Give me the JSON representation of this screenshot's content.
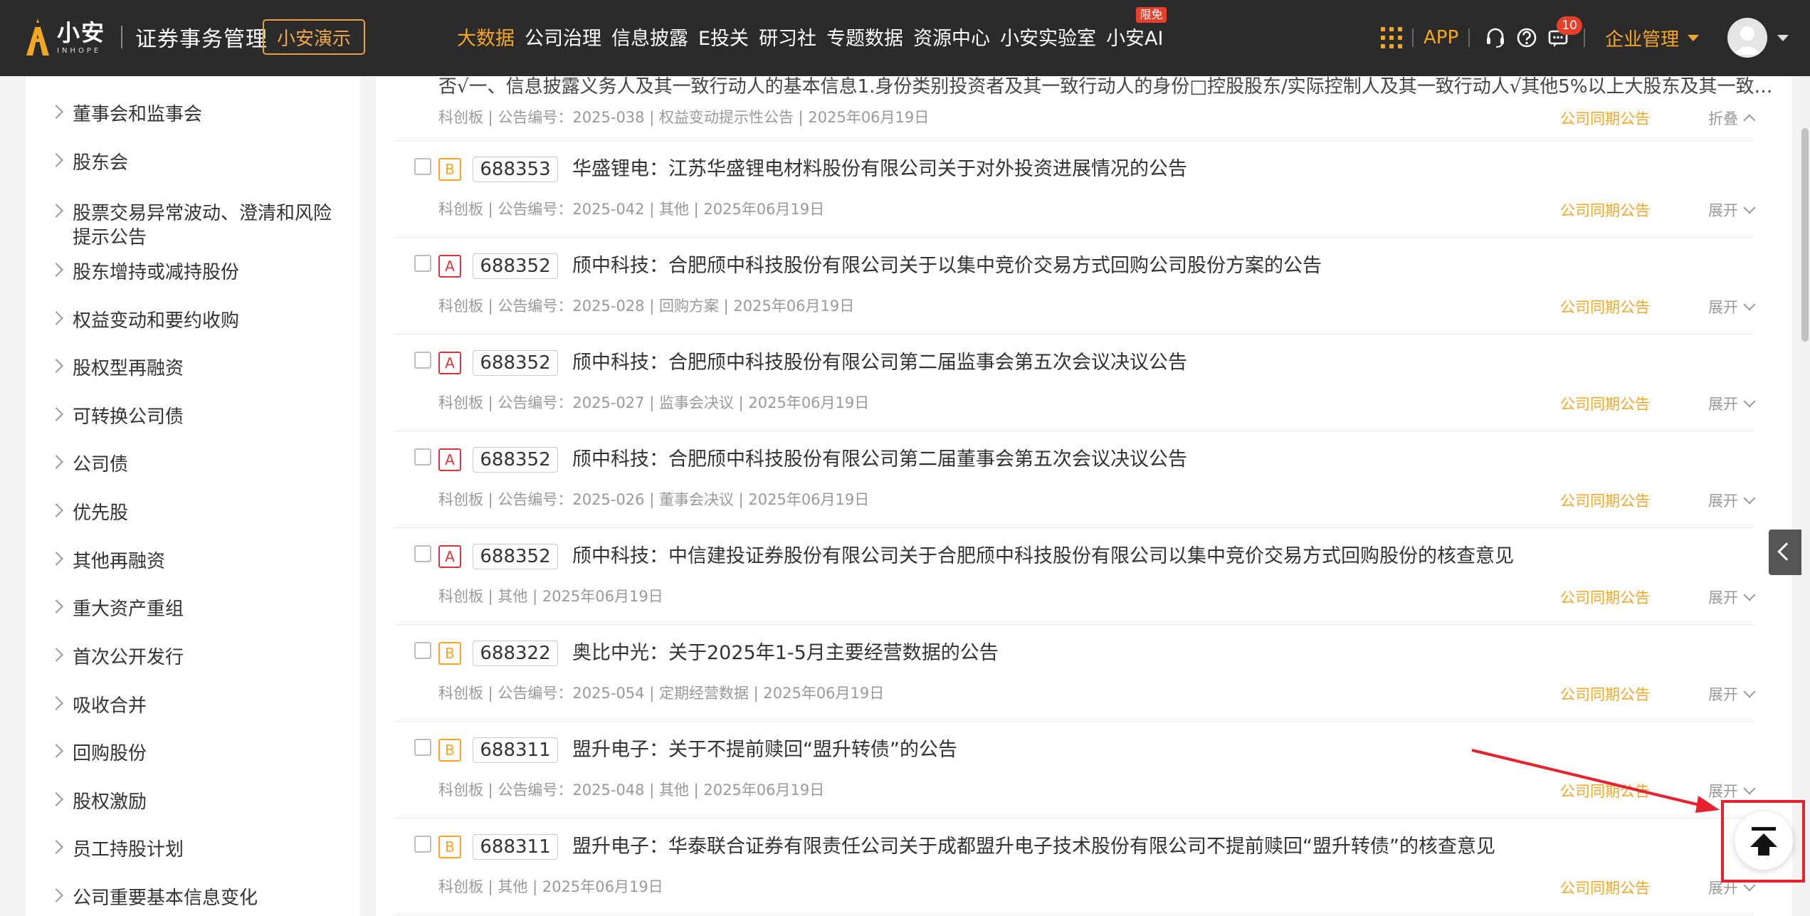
{
  "header": {
    "logo_main": "小安",
    "logo_sub": "INHOPE",
    "app_title": "证券事务管理",
    "demo_button": "小安演示",
    "nav": [
      {
        "label": "大数据",
        "active": true
      },
      {
        "label": "公司治理"
      },
      {
        "label": "信息披露"
      },
      {
        "label": "E投关"
      },
      {
        "label": "研习社"
      },
      {
        "label": "专题数据"
      },
      {
        "label": "资源中心"
      },
      {
        "label": "小安实验室"
      },
      {
        "label": "小安AI",
        "badge": "限免"
      }
    ],
    "app_link": "APP",
    "message_count": "10",
    "enterprise_menu": "企业管理"
  },
  "sidebar": {
    "items": [
      {
        "label": "董事会和监事会"
      },
      {
        "label": "股东会"
      },
      {
        "label": "股票交易异常波动、澄清和风险提示公告"
      },
      {
        "label": "股东增持或减持股份"
      },
      {
        "label": "权益变动和要约收购"
      },
      {
        "label": "股权型再融资"
      },
      {
        "label": "可转换公司债"
      },
      {
        "label": "公司债"
      },
      {
        "label": "优先股"
      },
      {
        "label": "其他再融资"
      },
      {
        "label": "重大资产重组"
      },
      {
        "label": "首次公开发行"
      },
      {
        "label": "吸收合并"
      },
      {
        "label": "回购股份"
      },
      {
        "label": "股权激励"
      },
      {
        "label": "员工持股计划"
      },
      {
        "label": "公司重要基本信息变化"
      }
    ]
  },
  "list": {
    "truncated_row": {
      "text": "否√一、信息披露义务人及其一致行动人的基本信息1.身份类别投资者及其一致行动人的身份□控股股东/实际控制人及其一致行动人√其他5%以上大股东及其一致行动人…",
      "meta": "科创板 | 公告编号：2025-038 | 权益变动提示性公告 | 2025年06月19日",
      "peer": "公司同期公告",
      "toggle": "折叠"
    },
    "rows": [
      {
        "grade": "B",
        "code": "688353",
        "title": "华盛锂电：江苏华盛锂电材料股份有限公司关于对外投资进展情况的公告",
        "meta": "科创板 | 公告编号：2025-042 | 其他 | 2025年06月19日",
        "peer": "公司同期公告",
        "toggle": "展开"
      },
      {
        "grade": "A",
        "code": "688352",
        "title": "颀中科技：合肥颀中科技股份有限公司关于以集中竞价交易方式回购公司股份方案的公告",
        "meta": "科创板 | 公告编号：2025-028 | 回购方案 | 2025年06月19日",
        "peer": "公司同期公告",
        "toggle": "展开"
      },
      {
        "grade": "A",
        "code": "688352",
        "title": "颀中科技：合肥颀中科技股份有限公司第二届监事会第五次会议决议公告",
        "meta": "科创板 | 公告编号：2025-027 | 监事会决议 | 2025年06月19日",
        "peer": "公司同期公告",
        "toggle": "展开"
      },
      {
        "grade": "A",
        "code": "688352",
        "title": "颀中科技：合肥颀中科技股份有限公司第二届董事会第五次会议决议公告",
        "meta": "科创板 | 公告编号：2025-026 | 董事会决议 | 2025年06月19日",
        "peer": "公司同期公告",
        "toggle": "展开"
      },
      {
        "grade": "A",
        "code": "688352",
        "title": "颀中科技：中信建投证券股份有限公司关于合肥颀中科技股份有限公司以集中竞价交易方式回购股份的核查意见",
        "meta": "科创板 | 其他 | 2025年06月19日",
        "peer": "公司同期公告",
        "toggle": "展开"
      },
      {
        "grade": "B",
        "code": "688322",
        "title": "奥比中光：关于2025年1-5月主要经营数据的公告",
        "meta": "科创板 | 公告编号：2025-054 | 定期经营数据 | 2025年06月19日",
        "peer": "公司同期公告",
        "toggle": "展开"
      },
      {
        "grade": "B",
        "code": "688311",
        "title": "盟升电子：关于不提前赎回“盟升转债”的公告",
        "meta": "科创板 | 公告编号：2025-048 | 其他 | 2025年06月19日",
        "peer": "公司同期公告",
        "toggle": "展开"
      },
      {
        "grade": "B",
        "code": "688311",
        "title": "盟升电子：华泰联合证券有限责任公司关于成都盟升电子技术股份有限公司不提前赎回“盟升转债”的核查意见",
        "meta": "科创板 | 其他 | 2025年06月19日",
        "peer": "公司同期公告",
        "toggle": "展开"
      }
    ]
  },
  "colors": {
    "accent": "#f5a623",
    "header_bg": "#2b2b2b",
    "grade_a": "#d9363e",
    "highlight": "#e8212e"
  }
}
